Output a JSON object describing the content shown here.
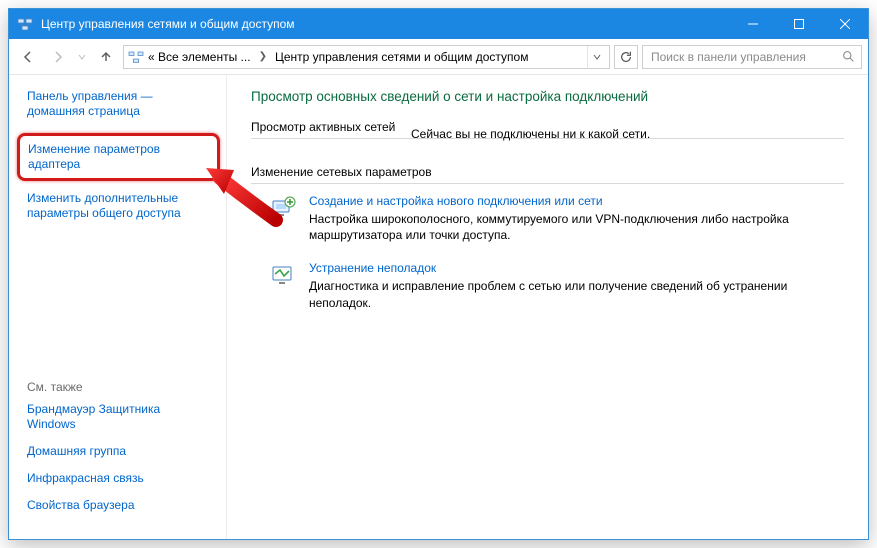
{
  "window": {
    "title": "Центр управления сетями и общим доступом"
  },
  "addressbar": {
    "seg1": "« Все элементы ...",
    "seg2": "Центр управления сетями и общим доступом"
  },
  "search": {
    "placeholder": "Поиск в панели управления"
  },
  "sidebar": {
    "home": "Панель управления — домашняя страница",
    "items": [
      "Изменение параметров адаптера",
      "Изменить дополнительные параметры общего доступа"
    ],
    "see_also_header": "См. также",
    "see_also": [
      "Брандмауэр Защитника Windows",
      "Домашняя группа",
      "Инфракрасная связь",
      "Свойства браузера"
    ]
  },
  "content": {
    "heading": "Просмотр основных сведений о сети и настройка подключений",
    "active_nets_label": "Просмотр активных сетей",
    "active_nets_status": "Сейчас вы не подключены ни к какой сети.",
    "change_settings_label": "Изменение сетевых параметров",
    "tasks": [
      {
        "title": "Создание и настройка нового подключения или сети",
        "desc": "Настройка широкополосного, коммутируемого или VPN-подключения либо настройка маршрутизатора или точки доступа."
      },
      {
        "title": "Устранение неполадок",
        "desc": "Диагностика и исправление проблем с сетью или получение сведений об устранении неполадок."
      }
    ]
  }
}
